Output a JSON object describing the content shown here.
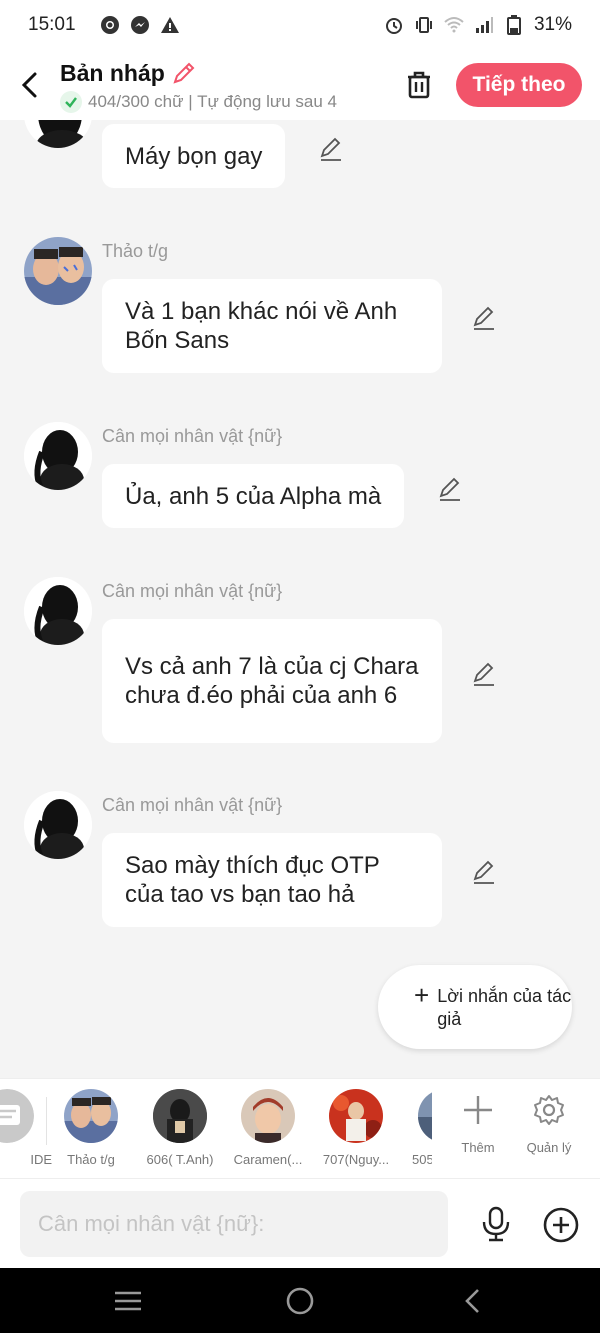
{
  "status_bar": {
    "time": "15:01",
    "battery": "31%"
  },
  "header": {
    "title": "Bản nháp",
    "subtitle": "404/300 chữ | Tự động lưu sau 4",
    "next_label": "Tiếp theo"
  },
  "messages": [
    {
      "name": "",
      "text": "Máy bọn gay"
    },
    {
      "name": "Thảo t/g",
      "text": "Và 1 bạn khác nói về Anh Bốn Sans"
    },
    {
      "name": "Cân mọi nhân vật {nữ}",
      "text": "Ủa, anh 5 của Alpha mà"
    },
    {
      "name": "Cân mọi nhân vật {nữ}",
      "text": "Vs cả anh 7 là của cj Chara chưa đ.éo phải của anh 6"
    },
    {
      "name": "Cân mọi nhân vật {nữ}",
      "text": "Sao mày thích đục OTP của tao vs bạn tao hả"
    }
  ],
  "author_note": {
    "label": "Lời nhắn của tác giả"
  },
  "characters": [
    {
      "label": "IDE"
    },
    {
      "label": "Thảo t/g"
    },
    {
      "label": "606( T.Anh)"
    },
    {
      "label": "Caramen(..."
    },
    {
      "label": "707(Nguy..."
    },
    {
      "label": "505"
    }
  ],
  "tools": {
    "add_label": "Thêm",
    "manage_label": "Quản lý"
  },
  "input": {
    "placeholder": "Cân mọi nhân vật {nữ}:"
  },
  "colors": {
    "accent": "#f2546a",
    "background": "#f4f4f4",
    "bubble": "#ffffff"
  }
}
